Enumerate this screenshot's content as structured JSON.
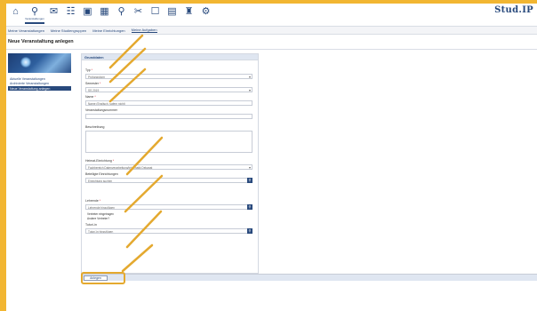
{
  "brand": "Stud.IP",
  "nav": [
    {
      "icon": "home-icon",
      "glyph": "⌂",
      "label": ""
    },
    {
      "icon": "courses-icon",
      "glyph": "⚲",
      "label": "Veranstaltungen"
    },
    {
      "icon": "messages-icon",
      "glyph": "✉",
      "label": ""
    },
    {
      "icon": "community-icon",
      "glyph": "☷",
      "label": ""
    },
    {
      "icon": "profile-icon",
      "glyph": "▣",
      "label": ""
    },
    {
      "icon": "schedule-icon",
      "glyph": "▦",
      "label": ""
    },
    {
      "icon": "search-icon",
      "glyph": "⚲",
      "label": ""
    },
    {
      "icon": "tools-icon",
      "glyph": "✂",
      "label": ""
    },
    {
      "icon": "files-icon",
      "glyph": "☐",
      "label": ""
    },
    {
      "icon": "images-icon",
      "glyph": "▤",
      "label": ""
    },
    {
      "icon": "admin-icon",
      "glyph": "♜",
      "label": ""
    },
    {
      "icon": "settings-icon",
      "glyph": "⚙",
      "label": ""
    }
  ],
  "tabs": [
    "Meine Veranstaltungen",
    "Meine Studiengruppen",
    "Meine Einrichtungen",
    "Meine Aufgaben"
  ],
  "page_title": "Neue Veranstaltung anlegen",
  "sidebar": {
    "links": [
      "Aktuelle Veranstaltungen",
      "Archivierte Veranstaltungen",
      "Neue Veranstaltung anlegen"
    ]
  },
  "form": {
    "section": "Grunddaten",
    "type_label": "Typ",
    "type_value": "Prüfungsform",
    "semester_label": "Semester",
    "semester_value": "SS 2019",
    "name_label": "Name",
    "name_placeholder": "Name (Englisch, sofern nicht)",
    "number_label": "Veranstaltungsnummer",
    "description_label": "Beschreibung",
    "institute_label": "Heimat-Einrichtung",
    "institute_value": "Fachbereich Datenverarbeitung/Informatik Dekanat",
    "other_institutes_label": "Beteiligte Einrichtungen",
    "other_institutes_placeholder": "Einrichtung suchen",
    "lecturers_label": "Lehrende",
    "lecturers_placeholder": "Lehrende hinzufügen",
    "deputy_check": "Vertreter eingetragen",
    "deputy_check2": "Andere Vertreter?",
    "tutors_label": "Tutor/-in",
    "tutors_placeholder": "Tutor/-in hinzufügen",
    "create_button": "Anlegen"
  },
  "colors": {
    "accent": "#28497c",
    "annotation": "#e4a92f",
    "frame": "#f2b632"
  }
}
